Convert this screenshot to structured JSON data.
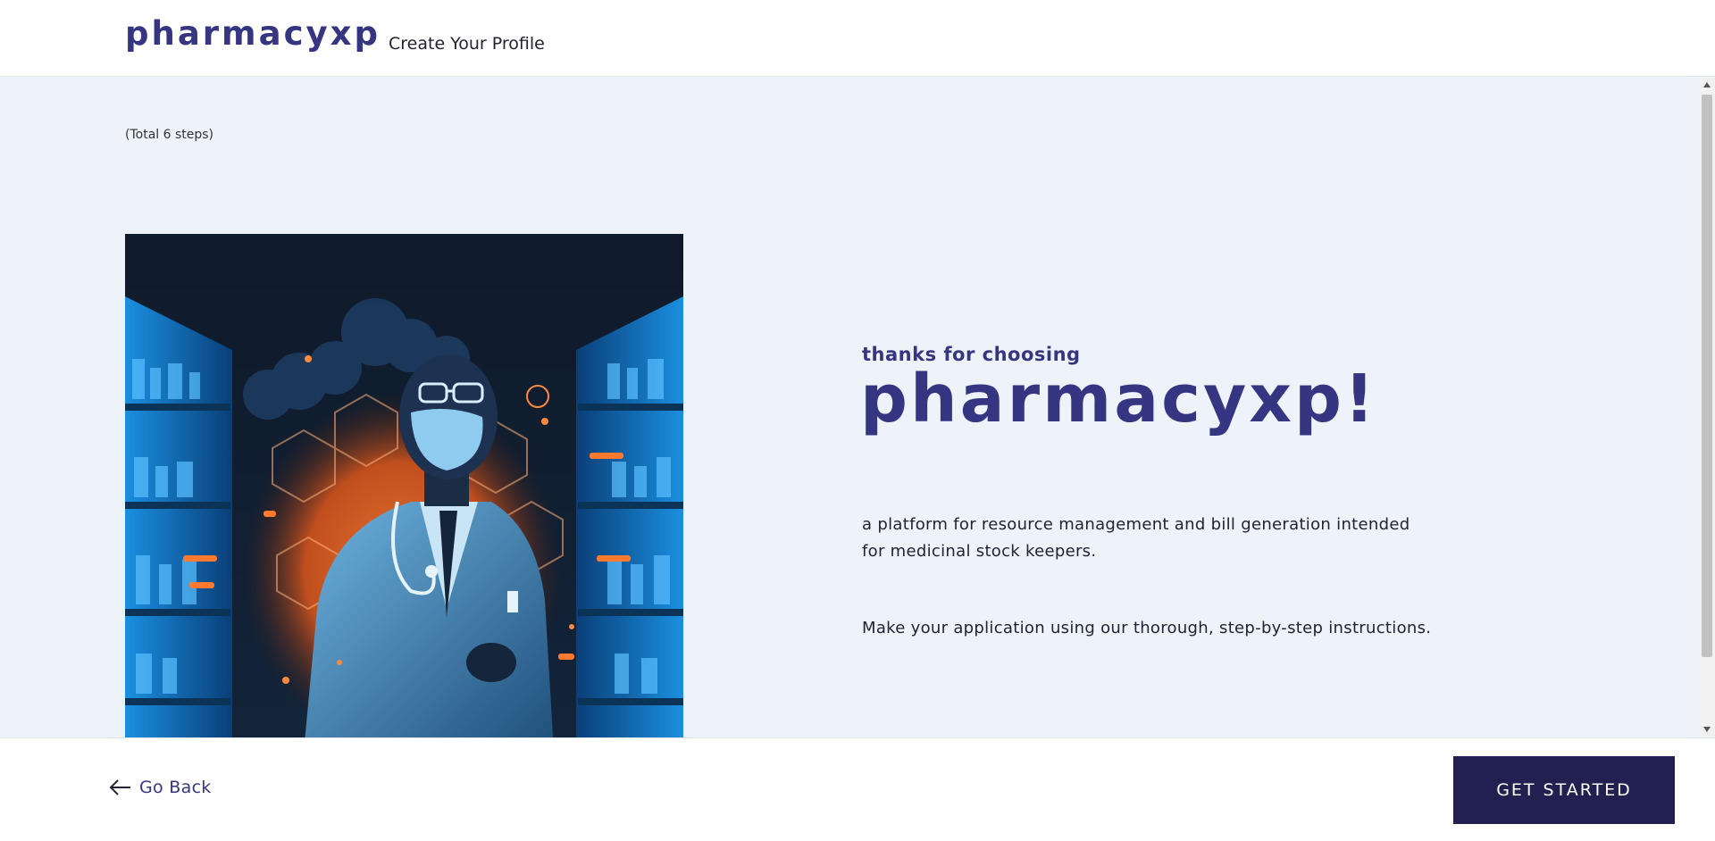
{
  "header": {
    "logo": "pharmacyxp",
    "title": "Create Your Profile"
  },
  "main": {
    "steps_note": "(Total 6 steps)",
    "tagline": "thanks for choosing",
    "hero_title": "pharmacyxp!",
    "description": "a platform for resource management and bill generation intended for medicinal stock keepers.",
    "instructions": "Make your application using our thorough, step-by-step instructions.",
    "illustration_icon": "pharmacist-illustration"
  },
  "footer": {
    "go_back_label": "Go Back",
    "get_started_label": "GET STARTED"
  },
  "colors": {
    "brand": "#353582",
    "button_bg": "#212050",
    "page_bg": "#eef3f9"
  }
}
